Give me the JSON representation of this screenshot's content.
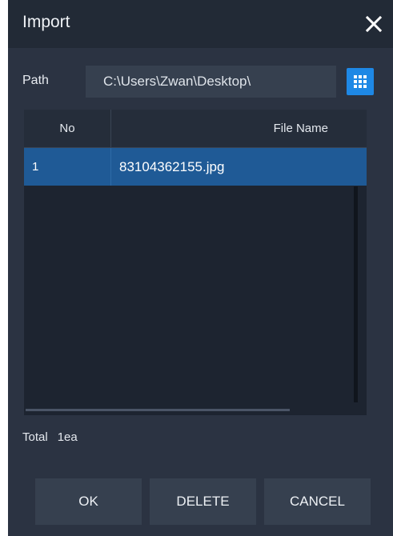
{
  "dialog": {
    "title": "Import",
    "path_label": "Path",
    "path_value": "C:\\Users\\Zwan\\Desktop\\"
  },
  "grid": {
    "columns": [
      "No",
      "File Name"
    ],
    "rows": [
      {
        "no": "1",
        "file_name": "83104362155.jpg"
      }
    ]
  },
  "footer": {
    "total_label": "Total",
    "total_value": "1ea"
  },
  "buttons": {
    "ok": "OK",
    "delete": "DELETE",
    "cancel": "CANCEL"
  },
  "colors": {
    "title_bar": "#222a36",
    "panel": "#2b3342",
    "accent": "#1e88e5",
    "selection": "#1f5a96"
  },
  "icons": {
    "close": "close-icon",
    "browse": "grid-icon"
  }
}
